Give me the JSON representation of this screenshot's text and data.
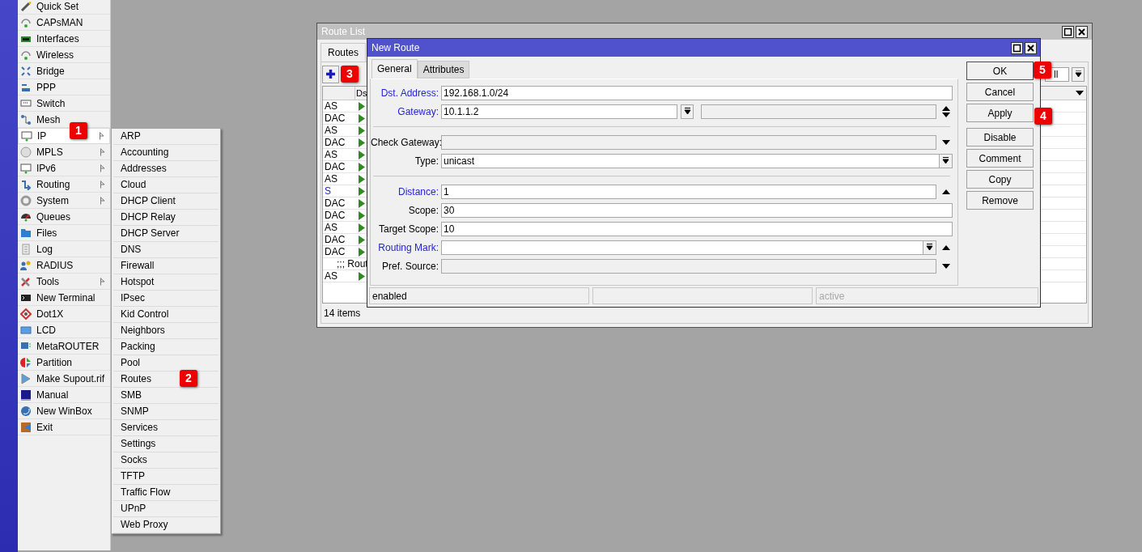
{
  "sidebar": {
    "items": [
      {
        "label": "Quick Set",
        "submenu": false,
        "selected": false
      },
      {
        "label": "CAPsMAN",
        "submenu": false,
        "selected": false
      },
      {
        "label": "Interfaces",
        "submenu": false,
        "selected": false
      },
      {
        "label": "Wireless",
        "submenu": false,
        "selected": false
      },
      {
        "label": "Bridge",
        "submenu": false,
        "selected": false
      },
      {
        "label": "PPP",
        "submenu": false,
        "selected": false
      },
      {
        "label": "Switch",
        "submenu": false,
        "selected": false
      },
      {
        "label": "Mesh",
        "submenu": false,
        "selected": false
      },
      {
        "label": "IP",
        "submenu": true,
        "selected": true
      },
      {
        "label": "MPLS",
        "submenu": true,
        "selected": false
      },
      {
        "label": "IPv6",
        "submenu": true,
        "selected": false
      },
      {
        "label": "Routing",
        "submenu": true,
        "selected": false
      },
      {
        "label": "System",
        "submenu": true,
        "selected": false
      },
      {
        "label": "Queues",
        "submenu": false,
        "selected": false
      },
      {
        "label": "Files",
        "submenu": false,
        "selected": false
      },
      {
        "label": "Log",
        "submenu": false,
        "selected": false
      },
      {
        "label": "RADIUS",
        "submenu": false,
        "selected": false
      },
      {
        "label": "Tools",
        "submenu": true,
        "selected": false
      },
      {
        "label": "New Terminal",
        "submenu": false,
        "selected": false
      },
      {
        "label": "Dot1X",
        "submenu": false,
        "selected": false
      },
      {
        "label": "LCD",
        "submenu": false,
        "selected": false
      },
      {
        "label": "MetaROUTER",
        "submenu": false,
        "selected": false
      },
      {
        "label": "Partition",
        "submenu": false,
        "selected": false
      },
      {
        "label": "Make Supout.rif",
        "submenu": false,
        "selected": false
      },
      {
        "label": "Manual",
        "submenu": false,
        "selected": false
      },
      {
        "label": "New WinBox",
        "submenu": false,
        "selected": false
      },
      {
        "label": "Exit",
        "submenu": false,
        "selected": false
      }
    ]
  },
  "submenu": {
    "items": [
      "ARP",
      "Accounting",
      "Addresses",
      "Cloud",
      "DHCP Client",
      "DHCP Relay",
      "DHCP Server",
      "DNS",
      "Firewall",
      "Hotspot",
      "IPsec",
      "Kid Control",
      "Neighbors",
      "Packing",
      "Pool",
      "Routes",
      "SMB",
      "SNMP",
      "Services",
      "Settings",
      "Socks",
      "TFTP",
      "Traffic Flow",
      "UPnP",
      "Web Proxy"
    ]
  },
  "route_list": {
    "title": "Route List",
    "tabs": [
      {
        "label": "Routes",
        "selected": true
      }
    ],
    "filter": "ll",
    "columns": [
      "Ds"
    ],
    "rows": [
      {
        "kind": "route",
        "flag": "AS",
        "color": "#000000"
      },
      {
        "kind": "route",
        "flag": "DAC",
        "color": "#000000"
      },
      {
        "kind": "route",
        "flag": "AS",
        "color": "#000000"
      },
      {
        "kind": "route",
        "flag": "DAC",
        "color": "#000000"
      },
      {
        "kind": "route",
        "flag": "AS",
        "color": "#000000"
      },
      {
        "kind": "route",
        "flag": "DAC",
        "color": "#000000"
      },
      {
        "kind": "route",
        "flag": "AS",
        "color": "#000000"
      },
      {
        "kind": "route",
        "flag": "S",
        "color": "#2020e0"
      },
      {
        "kind": "route",
        "flag": "DAC",
        "color": "#000000"
      },
      {
        "kind": "route",
        "flag": "DAC",
        "color": "#000000"
      },
      {
        "kind": "route",
        "flag": "AS",
        "color": "#000000"
      },
      {
        "kind": "route",
        "flag": "DAC",
        "color": "#000000"
      },
      {
        "kind": "route",
        "flag": "DAC",
        "color": "#000000"
      },
      {
        "kind": "comment",
        "text": ";;; Rout"
      },
      {
        "kind": "route",
        "flag": "AS",
        "color": "#000000"
      }
    ],
    "status": "14 items"
  },
  "new_route": {
    "title": "New Route",
    "tabs": [
      {
        "label": "General",
        "selected": true
      },
      {
        "label": "Attributes",
        "selected": false
      }
    ],
    "fields": [
      {
        "label": "Dst. Address:",
        "value": "192.168.1.0/24",
        "link": true,
        "disabled": false,
        "dropdown": false,
        "spin_up": false,
        "spin_down": false,
        "extra_field": false
      },
      {
        "label": "Gateway:",
        "value": "10.1.1.2",
        "link": true,
        "disabled": false,
        "dropdown": true,
        "spin_up": true,
        "spin_down": true,
        "extra_field": true
      },
      {
        "label": "Check Gateway:",
        "link": false,
        "disabled": true,
        "dropdown": false,
        "spin_up": false,
        "spin_down": true,
        "extra_field": false
      },
      {
        "label": "Type:",
        "value": "unicast",
        "link": false,
        "disabled": false,
        "dropdown": true,
        "spin_up": false,
        "spin_down": false,
        "extra_field": false
      },
      {
        "label": "Distance:",
        "value": "1",
        "link": true,
        "disabled": false,
        "dropdown": false,
        "spin_up": true,
        "spin_down": false,
        "extra_field": false
      },
      {
        "label": "Scope:",
        "value": "30",
        "link": false,
        "disabled": false,
        "dropdown": false,
        "spin_up": false,
        "spin_down": false,
        "extra_field": false
      },
      {
        "label": "Target Scope:",
        "value": "10",
        "link": false,
        "disabled": false,
        "dropdown": false,
        "spin_up": false,
        "spin_down": false,
        "extra_field": false
      },
      {
        "label": "Routing Mark:",
        "link": true,
        "disabled": false,
        "dropdown": true,
        "spin_up": true,
        "spin_down": false,
        "extra_field": false
      },
      {
        "label": "Pref. Source:",
        "link": false,
        "disabled": true,
        "dropdown": false,
        "spin_up": false,
        "spin_down": true,
        "extra_field": false
      }
    ],
    "buttons": [
      "OK",
      "Cancel",
      "Apply",
      "Disable",
      "Comment",
      "Copy",
      "Remove"
    ],
    "status": [
      {
        "text": "enabled",
        "greyed": false
      },
      {
        "text": "active",
        "greyed": true
      }
    ]
  },
  "annotations": [
    {
      "label": "1"
    },
    {
      "label": "2"
    },
    {
      "label": "3"
    },
    {
      "label": "4"
    },
    {
      "label": "5"
    }
  ]
}
